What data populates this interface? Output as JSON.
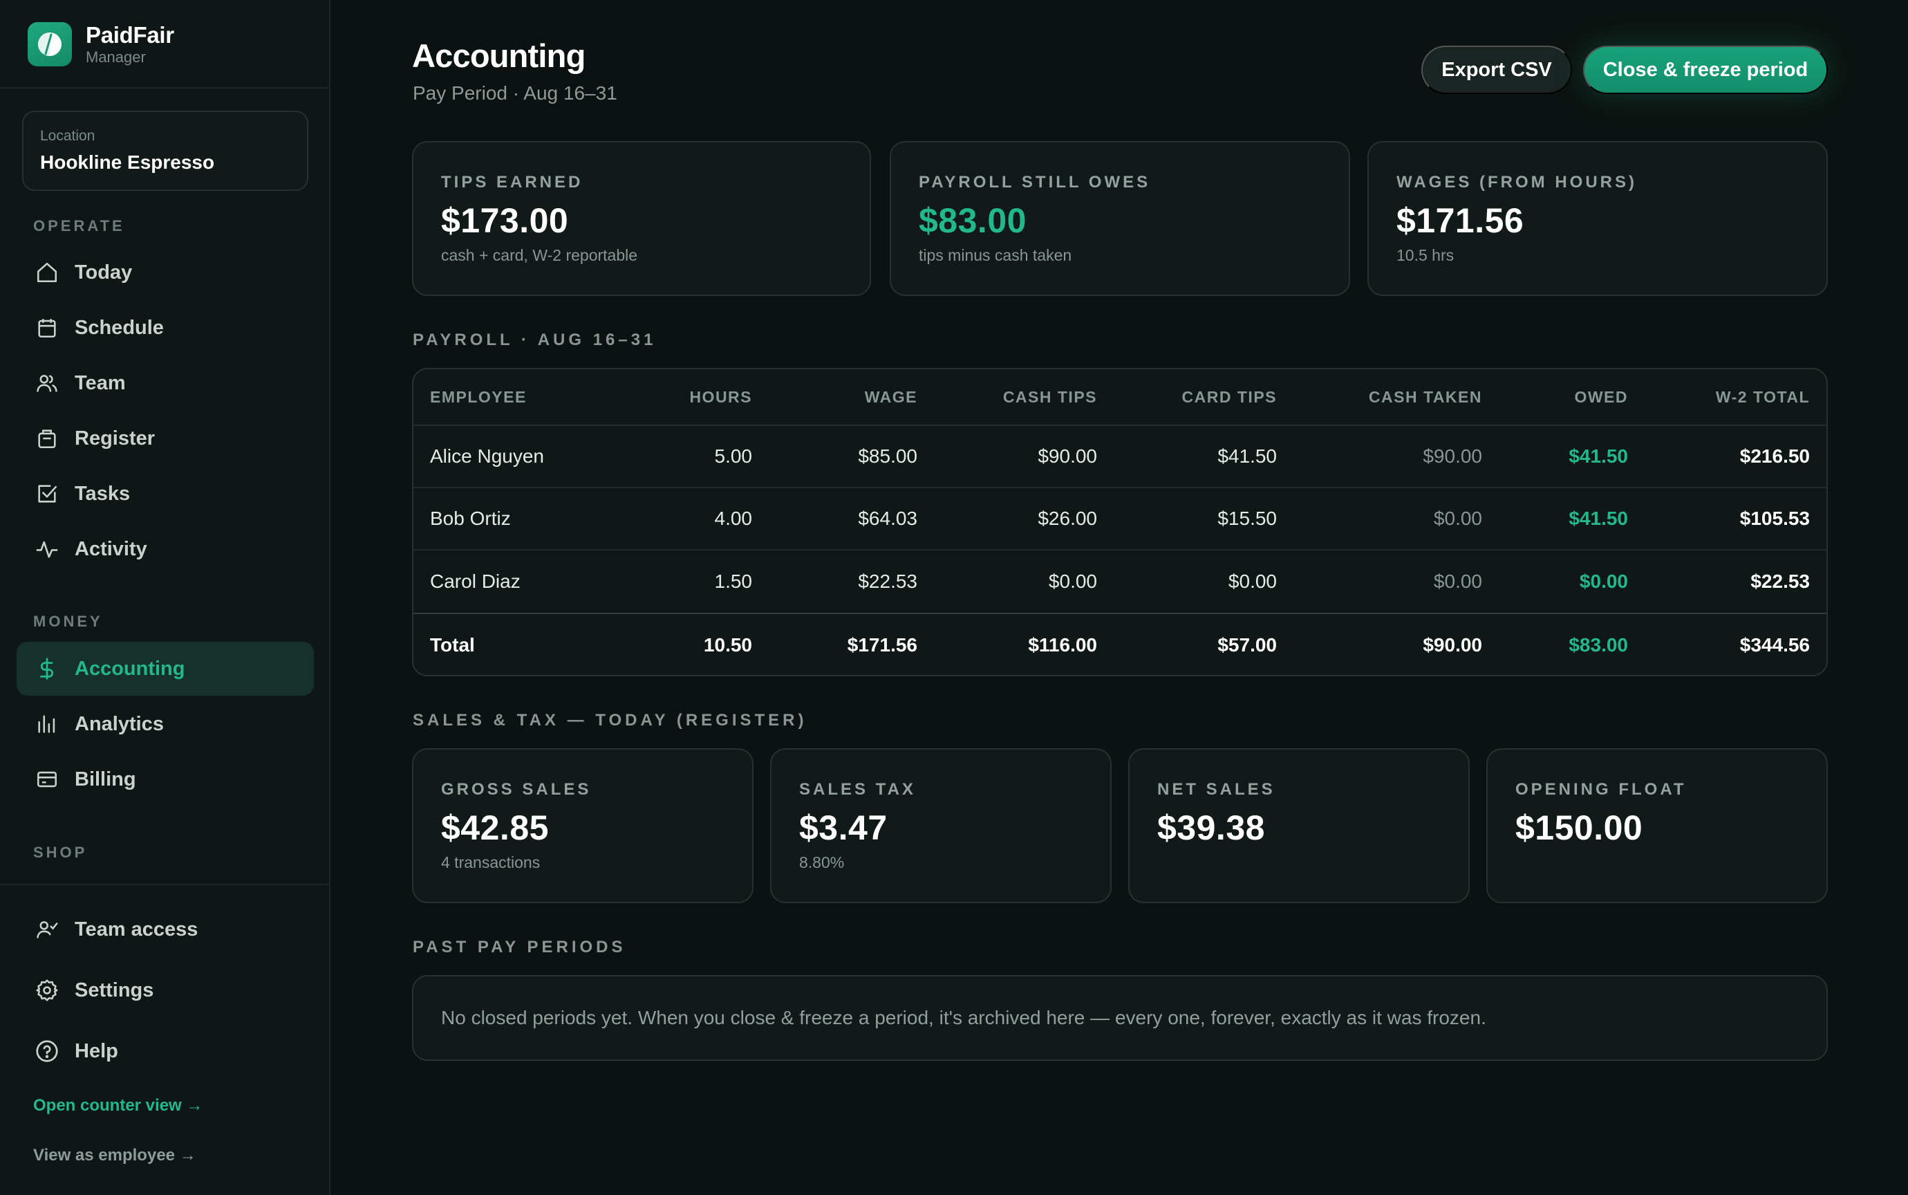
{
  "brand": {
    "name": "PaidFair",
    "subtitle": "Manager"
  },
  "location": {
    "label": "Location",
    "value": "Hookline Espresso"
  },
  "nav": {
    "operate_label": "OPERATE",
    "operate": [
      {
        "label": "Today",
        "icon": "home-icon"
      },
      {
        "label": "Schedule",
        "icon": "calendar-icon"
      },
      {
        "label": "Team",
        "icon": "users-icon"
      },
      {
        "label": "Register",
        "icon": "register-icon"
      },
      {
        "label": "Tasks",
        "icon": "checkbox-icon"
      },
      {
        "label": "Activity",
        "icon": "activity-icon"
      }
    ],
    "money_label": "MONEY",
    "money": [
      {
        "label": "Accounting",
        "icon": "dollar-icon",
        "active": true
      },
      {
        "label": "Analytics",
        "icon": "bar-chart-icon"
      },
      {
        "label": "Billing",
        "icon": "credit-card-icon"
      }
    ],
    "shop_label": "SHOP",
    "bottom": [
      {
        "label": "Team access",
        "icon": "team-access-icon"
      },
      {
        "label": "Settings",
        "icon": "gear-icon"
      },
      {
        "label": "Help",
        "icon": "help-icon"
      }
    ],
    "counter_link": "Open counter view →",
    "employee_link": "View as employee →"
  },
  "header": {
    "title": "Accounting",
    "subtitle": "Pay Period · Aug 16–31",
    "export_label": "Export CSV",
    "close_label": "Close & freeze period"
  },
  "summary": [
    {
      "label": "TIPS EARNED",
      "value": "$173.00",
      "note": "cash + card, W-2 reportable"
    },
    {
      "label": "PAYROLL STILL OWES",
      "value": "$83.00",
      "note": "tips minus cash taken"
    },
    {
      "label": "WAGES (FROM HOURS)",
      "value": "$171.56",
      "note": "10.5 hrs"
    }
  ],
  "payroll": {
    "section_label": "PAYROLL · AUG 16–31",
    "columns": [
      "EMPLOYEE",
      "HOURS",
      "WAGE",
      "CASH TIPS",
      "CARD TIPS",
      "CASH TAKEN",
      "OWED",
      "W-2 TOTAL"
    ],
    "rows": [
      {
        "name": "Alice Nguyen",
        "hours": "5.00",
        "wage": "$85.00",
        "cash_tips": "$90.00",
        "card_tips": "$41.50",
        "cash_taken": "$90.00",
        "owed": "$41.50",
        "w2": "$216.50"
      },
      {
        "name": "Bob Ortiz",
        "hours": "4.00",
        "wage": "$64.03",
        "cash_tips": "$26.00",
        "card_tips": "$15.50",
        "cash_taken": "$0.00",
        "owed": "$41.50",
        "w2": "$105.53"
      },
      {
        "name": "Carol Diaz",
        "hours": "1.50",
        "wage": "$22.53",
        "cash_tips": "$0.00",
        "card_tips": "$0.00",
        "cash_taken": "$0.00",
        "owed": "$0.00",
        "w2": "$22.53"
      }
    ],
    "total": {
      "name": "Total",
      "hours": "10.50",
      "wage": "$171.56",
      "cash_tips": "$116.00",
      "card_tips": "$57.00",
      "cash_taken": "$90.00",
      "owed": "$83.00",
      "w2": "$344.56"
    }
  },
  "sales": {
    "section_label": "SALES & TAX — TODAY (REGISTER)",
    "cards": [
      {
        "label": "GROSS SALES",
        "value": "$42.85",
        "note": "4 transactions"
      },
      {
        "label": "SALES TAX",
        "value": "$3.47",
        "note": "8.80%"
      },
      {
        "label": "NET SALES",
        "value": "$39.38",
        "note": ""
      },
      {
        "label": "OPENING FLOAT",
        "value": "$150.00",
        "note": ""
      }
    ]
  },
  "past": {
    "section_label": "PAST PAY PERIODS",
    "empty_text": "No closed periods yet. When you close & freeze a period, it's archived here — every one, forever, exactly as it was frozen."
  },
  "colors": {
    "accent": "#22b88a",
    "background": "#0c1211",
    "card": "#111a19"
  }
}
